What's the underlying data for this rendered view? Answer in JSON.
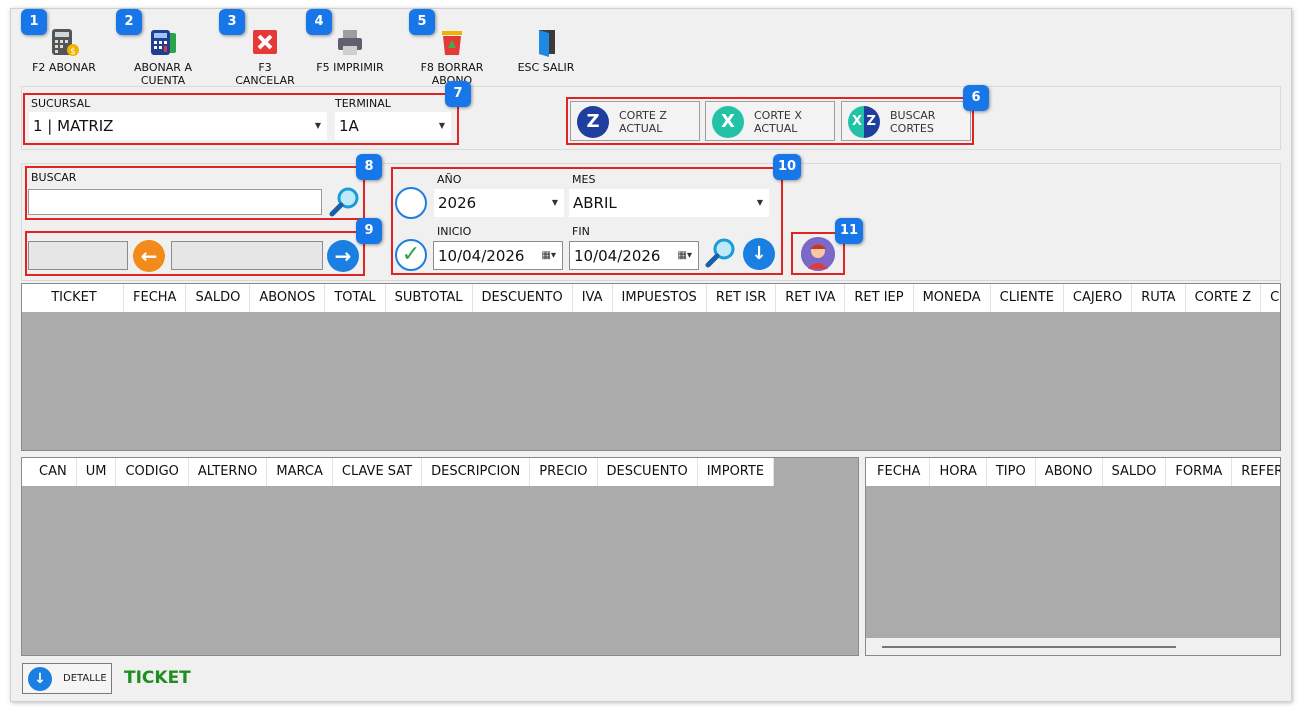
{
  "toolbar": {
    "items": [
      {
        "label": "F2 ABONAR",
        "badge": "1"
      },
      {
        "label": "ABONAR A CUENTA",
        "badge": "2"
      },
      {
        "label": "F3 CANCELAR",
        "badge": "3"
      },
      {
        "label": "F5 IMPRIMIR",
        "badge": "4"
      },
      {
        "label": "F8 BORRAR ABONO",
        "badge": "5"
      },
      {
        "label": "ESC SALIR"
      }
    ]
  },
  "sucursal": {
    "label": "SUCURSAL",
    "value": "1 | MATRIZ"
  },
  "terminal": {
    "label": "TERMINAL",
    "value": "1A"
  },
  "badges": {
    "b6": "6",
    "b7": "7",
    "b8": "8",
    "b9": "9",
    "b10": "10",
    "b11": "11"
  },
  "cortes": [
    {
      "letter": "Z",
      "line1": "CORTE Z",
      "line2": "ACTUAL"
    },
    {
      "letter": "X",
      "line1": "CORTE X",
      "line2": "ACTUAL"
    },
    {
      "letter": "X Z",
      "line1": "BUSCAR",
      "line2": "CORTES"
    }
  ],
  "buscar": {
    "label": "BUSCAR",
    "value": ""
  },
  "periodo": {
    "anio_label": "AÑO",
    "anio_value": "2026",
    "mes_label": "MES",
    "mes_value": "ABRIL",
    "inicio_label": "INICIO",
    "inicio_value": "10/04/2026",
    "fin_label": "FIN",
    "fin_value": "10/04/2026"
  },
  "tickets_grid": {
    "columns": [
      "TICKET",
      "FECHA",
      "SALDO",
      "ABONOS",
      "TOTAL",
      "SUBTOTAL",
      "DESCUENTO",
      "IVA",
      "IMPUESTOS",
      "RET ISR",
      "RET IVA",
      "RET IEP",
      "MONEDA",
      "CLIENTE",
      "CAJERO",
      "RUTA",
      "CORTE Z",
      "CORTE X"
    ]
  },
  "detalle_grid": {
    "columns": [
      "CAN",
      "UM",
      "CODIGO",
      "ALTERNO",
      "MARCA",
      "CLAVE SAT",
      "DESCRIPCION",
      "PRECIO",
      "DESCUENTO",
      "IMPORTE"
    ]
  },
  "abonos_grid": {
    "columns": [
      "FECHA",
      "HORA",
      "TIPO",
      "ABONO",
      "SALDO",
      "FORMA",
      "REFERENCIA"
    ]
  },
  "footer": {
    "detalle_label": "DETALLE",
    "ticket_label": "TICKET"
  },
  "colors": {
    "badge": "#1877e8",
    "highlight": "#e02424",
    "accent_blue": "#1a7fe0",
    "ticket_green": "#1e8e1e"
  }
}
